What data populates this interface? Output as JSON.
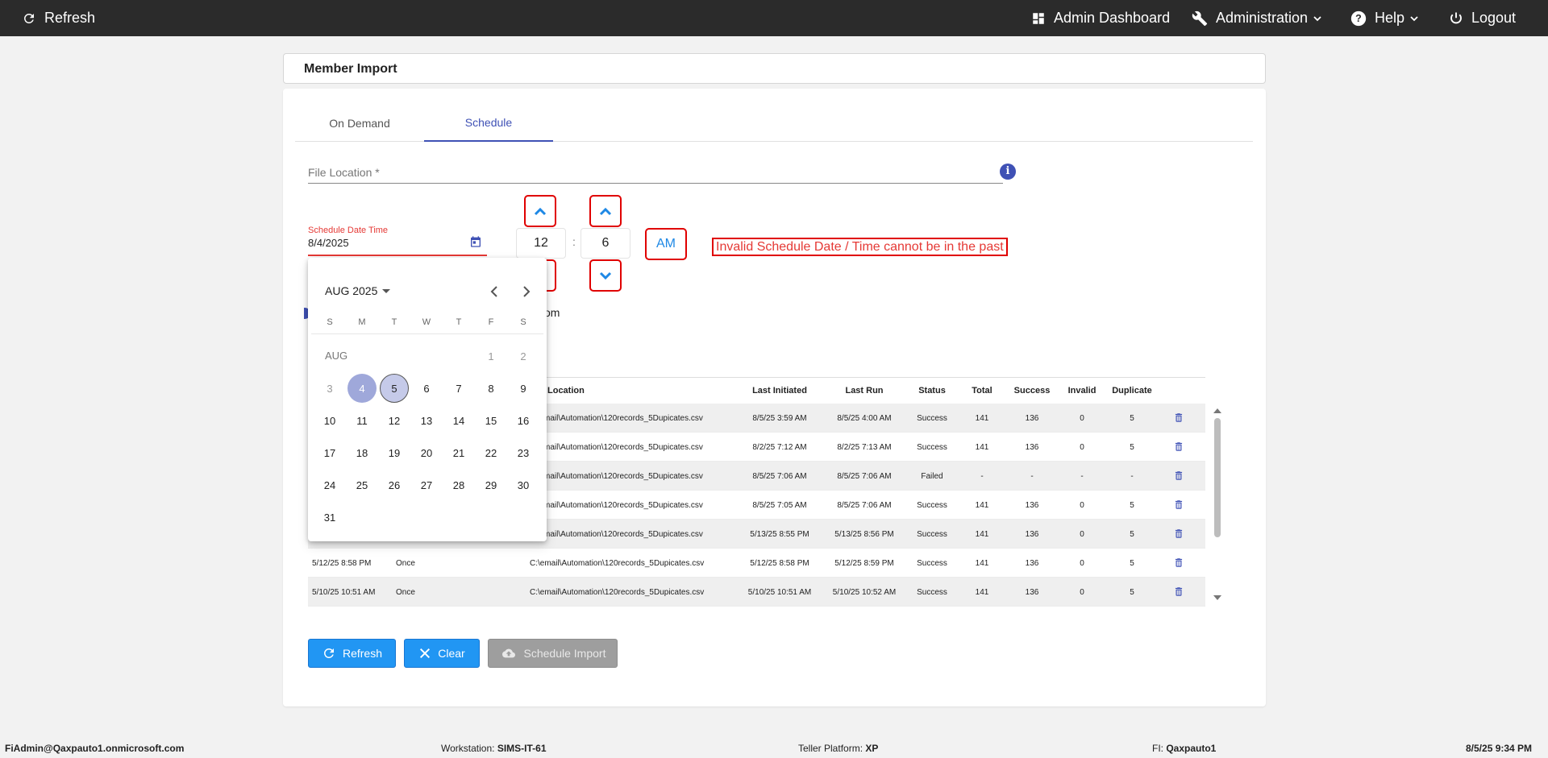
{
  "topbar": {
    "refresh_label": "Refresh",
    "admin_dashboard_label": "Admin Dashboard",
    "administration_label": "Administration",
    "help_label": "Help",
    "logout_label": "Logout"
  },
  "page": {
    "title": "Member Import"
  },
  "tabs": [
    {
      "label": "On Demand"
    },
    {
      "label": "Schedule"
    }
  ],
  "form": {
    "file_location_label": "File Location *",
    "schedule_label": "Schedule Date Time",
    "schedule_value": "8/4/2025",
    "hour": "12",
    "colon": ":",
    "minute": "6",
    "ampm": "AM",
    "error": "Invalid Schedule Date / Time cannot be in the past",
    "radio_partial_text": "om"
  },
  "calendar": {
    "period": "AUG 2025",
    "month_label": "AUG",
    "weekdays": [
      "S",
      "M",
      "T",
      "W",
      "T",
      "F",
      "S"
    ],
    "days": [
      "1",
      "2",
      "3",
      "4",
      "5",
      "6",
      "7",
      "8",
      "9",
      "10",
      "11",
      "12",
      "13",
      "14",
      "15",
      "16",
      "17",
      "18",
      "19",
      "20",
      "21",
      "22",
      "23",
      "24",
      "25",
      "26",
      "27",
      "28",
      "29",
      "30",
      "31"
    ],
    "selected_day": "4",
    "today_day": "5"
  },
  "table": {
    "headers": {
      "location": "Location",
      "last_initiated": "Last Initiated",
      "last_run": "Last Run",
      "status": "Status",
      "total": "Total",
      "success": "Success",
      "invalid": "Invalid",
      "duplicate": "Duplicate"
    },
    "rows": [
      {
        "scheduled": "",
        "frequency": "",
        "location": "mail\\Automation\\120records_5Dupicates.csv",
        "last_initiated": "8/5/25 3:59 AM",
        "last_run": "8/5/25 4:00 AM",
        "status": "Success",
        "total": "141",
        "success": "136",
        "invalid": "0",
        "duplicate": "5"
      },
      {
        "scheduled": "",
        "frequency": "",
        "location": "mail\\Automation\\120records_5Dupicates.csv",
        "last_initiated": "8/2/25 7:12 AM",
        "last_run": "8/2/25 7:13 AM",
        "status": "Success",
        "total": "141",
        "success": "136",
        "invalid": "0",
        "duplicate": "5"
      },
      {
        "scheduled": "",
        "frequency": "",
        "location": "mail\\Automation\\120records_5Dupicates.csv",
        "last_initiated": "8/5/25 7:06 AM",
        "last_run": "8/5/25 7:06 AM",
        "status": "Failed",
        "total": "-",
        "success": "-",
        "invalid": "-",
        "duplicate": "-"
      },
      {
        "scheduled": "",
        "frequency": "",
        "location": "mail\\Automation\\120records_5Dupicates.csv",
        "last_initiated": "8/5/25 7:05 AM",
        "last_run": "8/5/25 7:06 AM",
        "status": "Success",
        "total": "141",
        "success": "136",
        "invalid": "0",
        "duplicate": "5"
      },
      {
        "scheduled": "",
        "frequency": "",
        "location": "mail\\Automation\\120records_5Dupicates.csv",
        "last_initiated": "5/13/25 8:55 PM",
        "last_run": "5/13/25 8:56 PM",
        "status": "Success",
        "total": "141",
        "success": "136",
        "invalid": "0",
        "duplicate": "5"
      },
      {
        "scheduled": "5/12/25 8:58 PM",
        "frequency": "Once",
        "location": "C:\\email\\Automation\\120records_5Dupicates.csv",
        "last_initiated": "5/12/25 8:58 PM",
        "last_run": "5/12/25 8:59 PM",
        "status": "Success",
        "total": "141",
        "success": "136",
        "invalid": "0",
        "duplicate": "5"
      },
      {
        "scheduled": "5/10/25 10:51 AM",
        "frequency": "Once",
        "location": "C:\\email\\Automation\\120records_5Dupicates.csv",
        "last_initiated": "5/10/25 10:51 AM",
        "last_run": "5/10/25 10:52 AM",
        "status": "Success",
        "total": "141",
        "success": "136",
        "invalid": "0",
        "duplicate": "5"
      }
    ]
  },
  "buttons": {
    "refresh": "Refresh",
    "clear": "Clear",
    "schedule_import": "Schedule Import"
  },
  "status_bar": {
    "user": "FiAdmin@Qaxpauto1.onmicrosoft.com",
    "workstation_label": "Workstation:",
    "workstation_value": "SIMS-IT-61",
    "teller_label": "Teller Platform:",
    "teller_value": "XP",
    "fi_label": "FI:",
    "fi_value": "Qaxpauto1",
    "datetime": "8/5/25 9:34 PM"
  },
  "colors": {
    "topbar": "#2b2b2b",
    "accent": "#3f51b5",
    "button_blue": "#2196f3",
    "error": "#e53935"
  }
}
